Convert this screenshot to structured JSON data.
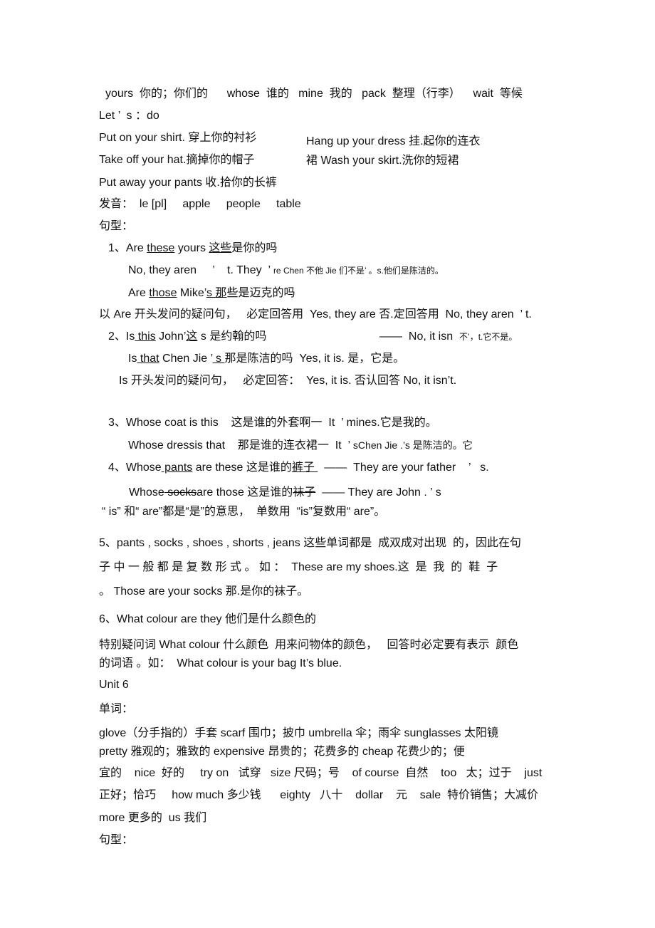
{
  "document": {
    "vocab_line_1": "yours  你的；你们的      whose  谁的   mine  我的   pack  整理（行李）    wait  等候",
    "lets_do_heading": "Let ’  s ：do",
    "lets_do": {
      "put_on": "Put on your shirt. 穿上你的衬衫",
      "hang_up_1": "Hang up your dress 挂.起你的连衣",
      "take_off": "Take off your hat.摘掉你的帽子",
      "hang_up_2": "裙 Wash your skirt.洗你的短裙",
      "put_away": "Put away your pants 收.拾你的长裤"
    },
    "pronunciation": "发音：  le [pl]     apple     people     table",
    "sentence_heading_1": "句型：",
    "s1": {
      "num": "1、Are ",
      "u1": "these",
      "mid": " yours ",
      "u2": "这些",
      "rest": "是你的吗",
      "answer_a": "No, they aren     ’    t. They  ’ ",
      "answer_b": "re Chen 不他 Jie 们不是’ 。s.他们是陈洁的。",
      "q2_pre": "Are ",
      "q2_u": "those",
      "q2_mid": " Mike’",
      "q2_u2": "s 那",
      "q2_rest": "些是迈克的吗",
      "note": "以 Are 开头发问的疑问句，   必定回答用  Yes, they are 否.定回答用  No, they aren  ’ t."
    },
    "s2": {
      "num": "2、Is",
      "u1": " this",
      "mid": " John’",
      "u2": "这",
      "rest": " s 是约翰的吗",
      "dash_answer": "——  No, it isn  ",
      "dash_answer_sm": "不’，t.它不是。",
      "q2_pre": "Is",
      "q2_u": " that",
      "q2_mid": " Chen Jie ’",
      "q2_u2": " s ",
      "q2_rest": "那是陈洁的吗  Yes, it is. 是，它是。",
      "note": "Is 开头发问的疑问句，   必定回答：  Yes, it is. 否认回答 No, it isn’t."
    },
    "s3": {
      "line1": "3、Whose coat is this    这是谁的外套啊一  It  ’ mines.它是我的。",
      "line2_a": "Whose dressis that    那是谁的连衣裙一  It  ’ ",
      "line2_b": "sChen Jie .’s 是陈洁的。它"
    },
    "s4": {
      "num": "4、Whose",
      "u1": " pants",
      "mid": " are these 这是谁的",
      "u2": "裤子 ",
      "rest": "  ——  They are your father    ’   s.",
      "line2_pre": "Whose",
      "line2_strike": " socks",
      "line2_mid": "are those 这是谁的",
      "line2_strike2": "袜子",
      "line2_rest": "  —— They are John . ’ s"
    },
    "is_are_note": "“ is” 和“ are”都是“是”的意思，  单数用  “is”复数用“ are”。",
    "s5": {
      "line1": "5、pants , socks , shoes , shorts , jeans 这些单词都是  成双成对出现  的，因此在句",
      "line2": "子 中 一 般 都 是 复 数 形 式 。 如 ：  These are my shoes.这  是  我  的  鞋  子",
      "line3": "。 Those are your socks 那.是你的袜子。"
    },
    "s6": {
      "line1": "6、What colour are they 他们是什么颜色的",
      "line2": "特别疑问词 What colour 什么颜色  用来问物体的颜色，   回答时必定要有表示  颜色",
      "line3": "的词语 。如：  What colour is your bag It’s blue."
    },
    "unit_title": "Unit 6",
    "words_heading": "单词：",
    "unit6_words": [
      "glove（分手指的）手套 scarf 围巾；披巾 umbrella 伞；雨伞 sunglasses 太阳镜",
      "pretty 雅观的；雅致的 expensive 昂贵的；花费多的 cheap 花费少的；便",
      "宜的    nice  好的     try on   试穿   size 尺码；号    of course  自然    too   太；过于    just",
      "正好；恰巧     how much 多少钱      eighty   八十    dollar    元    sale  特价销售；大减价",
      "more 更多的  us 我们"
    ],
    "sentence_heading_2": "句型："
  }
}
